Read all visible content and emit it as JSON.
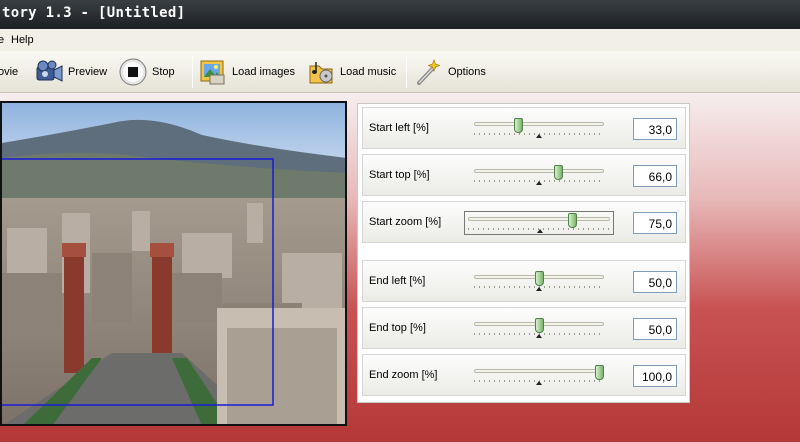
{
  "window": {
    "title": "tory 1.3 - [Untitled]"
  },
  "menu": {
    "items": [
      {
        "label": "e"
      },
      {
        "label": "Help"
      }
    ]
  },
  "toolbar": {
    "make_movie": {
      "label": "ovie",
      "icon": "film-reel-icon"
    },
    "preview": {
      "label": "Preview",
      "icon": "camera-icon"
    },
    "stop": {
      "label": "Stop",
      "icon": "stop-icon"
    },
    "load_images": {
      "label": "Load images",
      "icon": "image-icon"
    },
    "load_music": {
      "label": "Load music",
      "icon": "music-icon"
    },
    "options": {
      "label": "Options",
      "icon": "wand-icon"
    }
  },
  "controls": {
    "start_left": {
      "label": "Start left [%]",
      "value": "33,0",
      "level": 33
    },
    "start_top": {
      "label": "Start top [%]",
      "value": "66,0",
      "level": 66
    },
    "start_zoom": {
      "label": "Start zoom [%]",
      "value": "75,0",
      "level": 75
    },
    "end_left": {
      "label": "End left [%]",
      "value": "50,0",
      "level": 50
    },
    "end_top": {
      "label": "End top [%]",
      "value": "50,0",
      "level": 50
    },
    "end_zoom": {
      "label": "End zoom [%]",
      "value": "100,0",
      "level": 100
    }
  },
  "colors": {
    "selection_frame": "#1a1ad8",
    "titlebar": "#2a2e33",
    "accent": "#b53838"
  }
}
